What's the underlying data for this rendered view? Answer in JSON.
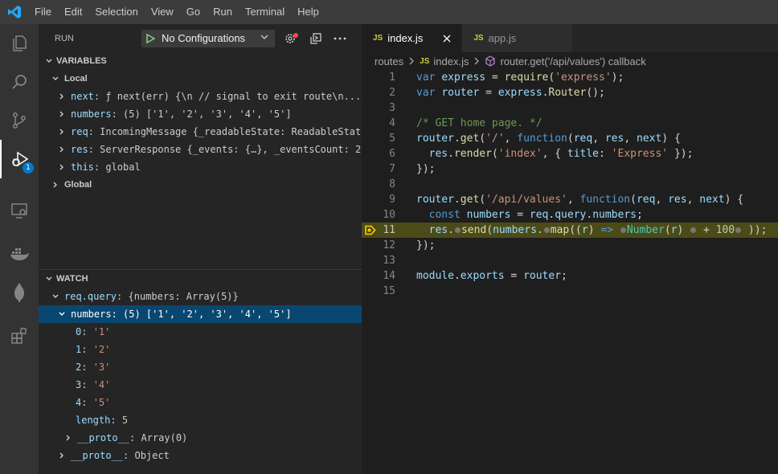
{
  "menu": [
    "File",
    "Edit",
    "Selection",
    "View",
    "Go",
    "Run",
    "Terminal",
    "Help"
  ],
  "activity": {
    "items": [
      "explorer-icon",
      "search-icon",
      "source-control-icon",
      "run-debug-icon",
      "remote-explorer-icon",
      "docker-icon",
      "mongodb-icon",
      "extensions-icon"
    ],
    "debug_badge": "1"
  },
  "run": {
    "title": "RUN",
    "config": "No Configurations"
  },
  "variables": {
    "header": "VARIABLES",
    "local_label": "Local",
    "items": [
      {
        "name": "next",
        "value": "ƒ next(err) {\\n    // signal to exit route\\n..."
      },
      {
        "name": "numbers",
        "value": "(5) ['1', '2', '3', '4', '5']"
      },
      {
        "name": "req",
        "value": "IncomingMessage {_readableState: ReadableStat..."
      },
      {
        "name": "res",
        "value": "ServerResponse {_events: {…}, _eventsCount: 2..."
      },
      {
        "name": "this",
        "value": "global"
      }
    ],
    "global_label": "Global"
  },
  "watch": {
    "header": "WATCH",
    "expr_name": "req.query",
    "expr_value": "{numbers: Array(5)}",
    "selected_name": "numbers",
    "selected_value": "(5) ['1', '2', '3', '4', '5']",
    "items": [
      {
        "name": "0",
        "value": "'1'"
      },
      {
        "name": "1",
        "value": "'2'"
      },
      {
        "name": "2",
        "value": "'3'"
      },
      {
        "name": "3",
        "value": "'4'"
      },
      {
        "name": "4",
        "value": "'5'"
      }
    ],
    "length_name": "length",
    "length_value": "5",
    "proto_array_name": "__proto__",
    "proto_array_value": "Array(0)",
    "proto_object_name": "__proto__",
    "proto_object_value": "Object"
  },
  "tabs": [
    {
      "label": "index.js",
      "badge": "JS"
    },
    {
      "label": "app.js",
      "badge": "JS"
    }
  ],
  "breadcrumb": {
    "folder": "routes",
    "file": "index.js",
    "file_badge": "JS",
    "symbol": "router.get('/api/values') callback"
  },
  "code": {
    "current_line": 11,
    "lines": [
      {
        "n": "1",
        "t": [
          [
            "kw",
            "var "
          ],
          [
            "id",
            "express"
          ],
          [
            "pl",
            " = "
          ],
          [
            "fn",
            "require"
          ],
          [
            "pl",
            "("
          ],
          [
            "str",
            "'express'"
          ],
          [
            "pl",
            ");"
          ]
        ]
      },
      {
        "n": "2",
        "t": [
          [
            "kw",
            "var "
          ],
          [
            "id",
            "router"
          ],
          [
            "pl",
            " = "
          ],
          [
            "id",
            "express"
          ],
          [
            "pl",
            "."
          ],
          [
            "fn",
            "Router"
          ],
          [
            "pl",
            "();"
          ]
        ]
      },
      {
        "n": "3",
        "t": []
      },
      {
        "n": "4",
        "t": [
          [
            "cm",
            "/* GET home page. */"
          ]
        ]
      },
      {
        "n": "5",
        "t": [
          [
            "id",
            "router"
          ],
          [
            "pl",
            "."
          ],
          [
            "fn",
            "get"
          ],
          [
            "pl",
            "("
          ],
          [
            "str",
            "'/'"
          ],
          [
            "pl",
            ", "
          ],
          [
            "kw",
            "function"
          ],
          [
            "pl",
            "("
          ],
          [
            "id",
            "req"
          ],
          [
            "pl",
            ", "
          ],
          [
            "id",
            "res"
          ],
          [
            "pl",
            ", "
          ],
          [
            "id",
            "next"
          ],
          [
            "pl",
            ") {"
          ]
        ]
      },
      {
        "n": "6",
        "t": [
          [
            "pl",
            "  "
          ],
          [
            "id",
            "res"
          ],
          [
            "pl",
            "."
          ],
          [
            "fn",
            "render"
          ],
          [
            "pl",
            "("
          ],
          [
            "str",
            "'index'"
          ],
          [
            "pl",
            ", { "
          ],
          [
            "id",
            "title"
          ],
          [
            "pl",
            ": "
          ],
          [
            "str",
            "'Express'"
          ],
          [
            "pl",
            " });"
          ]
        ]
      },
      {
        "n": "7",
        "t": [
          [
            "pl",
            "});"
          ]
        ]
      },
      {
        "n": "8",
        "t": []
      },
      {
        "n": "9",
        "t": [
          [
            "id",
            "router"
          ],
          [
            "pl",
            "."
          ],
          [
            "fn",
            "get"
          ],
          [
            "pl",
            "("
          ],
          [
            "str",
            "'/api/values'"
          ],
          [
            "pl",
            ", "
          ],
          [
            "kw",
            "function"
          ],
          [
            "pl",
            "("
          ],
          [
            "id",
            "req"
          ],
          [
            "pl",
            ", "
          ],
          [
            "id",
            "res"
          ],
          [
            "pl",
            ", "
          ],
          [
            "id",
            "next"
          ],
          [
            "pl",
            ") {"
          ]
        ]
      },
      {
        "n": "10",
        "t": [
          [
            "pl",
            "  "
          ],
          [
            "kw",
            "const "
          ],
          [
            "id",
            "numbers"
          ],
          [
            "pl",
            " = "
          ],
          [
            "id",
            "req"
          ],
          [
            "pl",
            "."
          ],
          [
            "id",
            "query"
          ],
          [
            "pl",
            "."
          ],
          [
            "id",
            "numbers"
          ],
          [
            "pl",
            ";"
          ]
        ]
      },
      {
        "n": "11",
        "t": [
          [
            "pl",
            "  "
          ],
          [
            "id",
            "res"
          ],
          [
            "pl",
            "."
          ],
          [
            "dot",
            ""
          ],
          [
            "fn",
            "send"
          ],
          [
            "pl",
            "("
          ],
          [
            "id",
            "numbers"
          ],
          [
            "pl",
            "."
          ],
          [
            "dot",
            ""
          ],
          [
            "fn",
            "map"
          ],
          [
            "pl",
            "(("
          ],
          [
            "id",
            "r"
          ],
          [
            "pl",
            ") "
          ],
          [
            "kw",
            "=>"
          ],
          [
            "pl",
            " "
          ],
          [
            "dot",
            ""
          ],
          [
            "cls",
            "Number"
          ],
          [
            "pl",
            "("
          ],
          [
            "id",
            "r"
          ],
          [
            "pl",
            ") "
          ],
          [
            "dot",
            ""
          ],
          [
            "pl",
            " + "
          ],
          [
            "num",
            "100"
          ],
          [
            "dot",
            ""
          ],
          [
            "pl",
            " ));"
          ]
        ]
      },
      {
        "n": "12",
        "t": [
          [
            "pl",
            "});"
          ]
        ]
      },
      {
        "n": "13",
        "t": []
      },
      {
        "n": "14",
        "t": [
          [
            "id",
            "module"
          ],
          [
            "pl",
            "."
          ],
          [
            "id",
            "exports"
          ],
          [
            "pl",
            " = "
          ],
          [
            "id",
            "router"
          ],
          [
            "pl",
            ";"
          ]
        ]
      },
      {
        "n": "15",
        "t": []
      }
    ]
  }
}
